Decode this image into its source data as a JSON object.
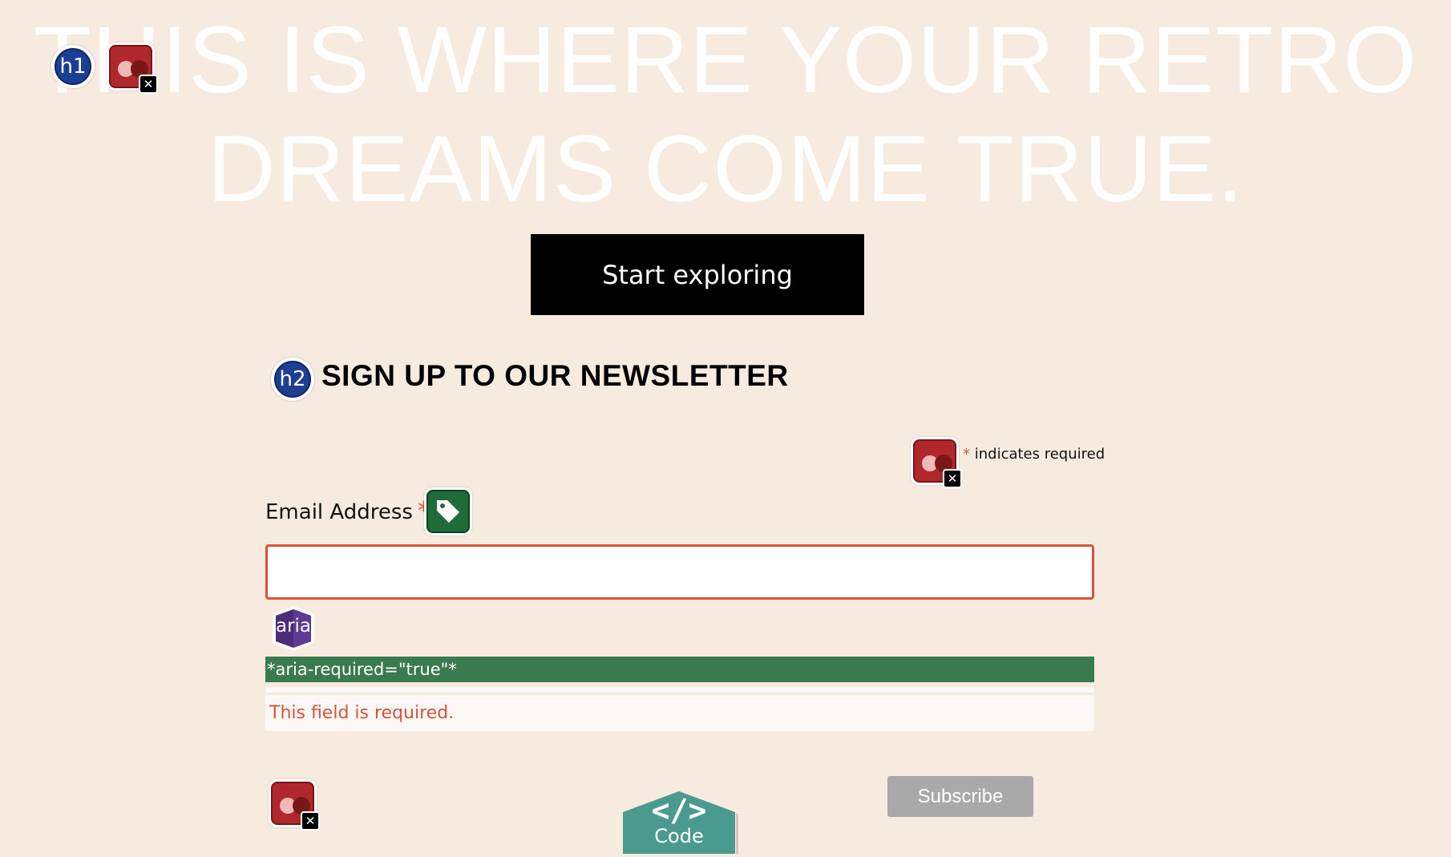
{
  "hero": {
    "line1": "THIS IS WHERE YOUR RETRO",
    "line2": "DREAMS COME TRUE.",
    "cta_label": "Start exploring"
  },
  "badges": {
    "h1": "h1",
    "h2": "h2",
    "aria": "aria",
    "code": "Code",
    "code_glyph": "</>"
  },
  "newsletter": {
    "title": "SIGN UP TO OUR NEWSLETTER",
    "required_star": "*",
    "required_note": "indicates required",
    "email_label": "Email Address",
    "email_value": "",
    "aria_annotation": "*aria-required=\"true\"*",
    "error_message": "This field is required.",
    "subscribe_label": "Subscribe"
  },
  "colors": {
    "background": "#f7ebdf",
    "accent_error": "#d9533a",
    "aria_bar": "#3a7a4f",
    "button_dark": "#000000",
    "button_disabled": "#a9a9a9",
    "code_tab": "#4a9a90"
  },
  "icons": [
    "h1-badge-icon",
    "contrast-error-icon",
    "h2-badge-icon",
    "tag-icon",
    "aria-icon",
    "code-icon"
  ]
}
